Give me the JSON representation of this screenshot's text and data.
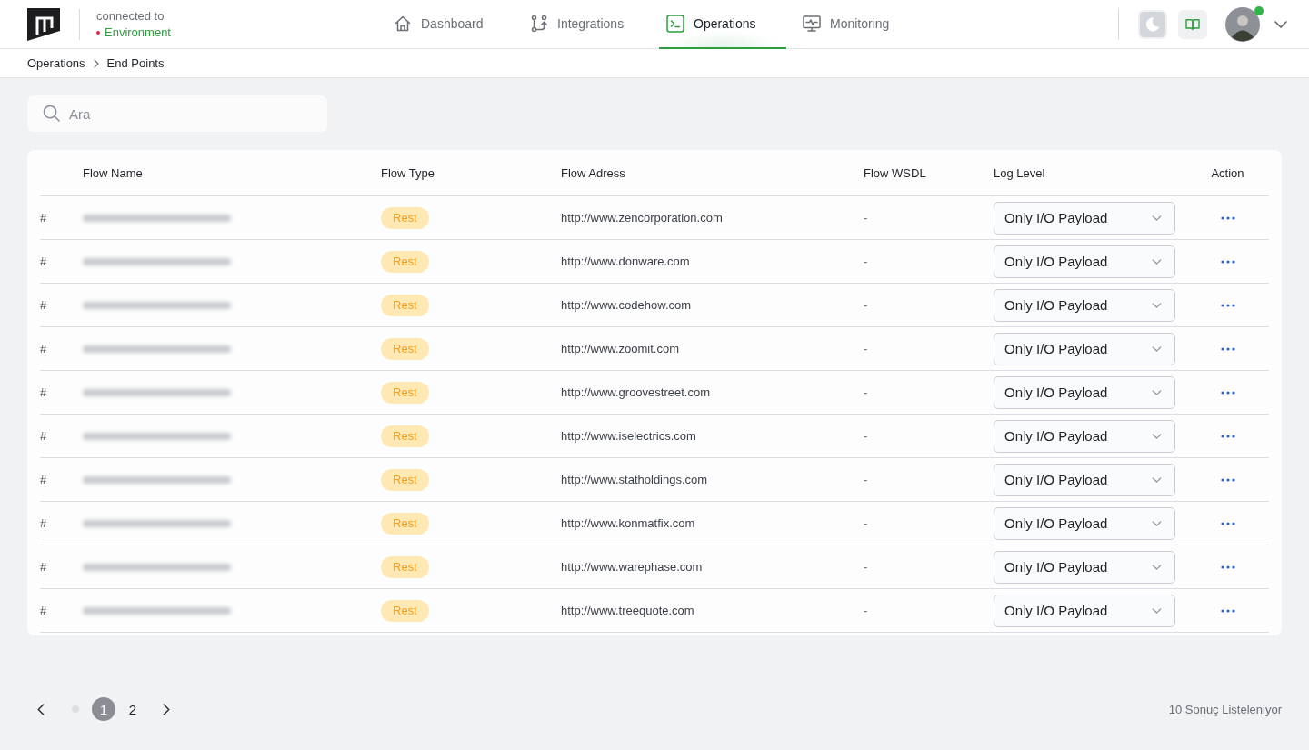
{
  "header": {
    "connection_label": "connected to",
    "environment": "Environment",
    "user": {
      "online": true
    }
  },
  "nav": [
    {
      "label": "Dashboard",
      "selected": false
    },
    {
      "label": "Integrations",
      "selected": false
    },
    {
      "label": "Operations",
      "selected": true
    },
    {
      "label": "Monitoring",
      "selected": false
    }
  ],
  "breadcrumb": [
    "Operations",
    "End Points"
  ],
  "search": {
    "placeholder": "Ara"
  },
  "table": {
    "columns": [
      "Flow Name",
      "Flow Type",
      "Flow Adress",
      "Flow WSDL",
      "Log Level",
      "Action"
    ],
    "rows": [
      {
        "index": "#",
        "flow_type": "Rest",
        "flow_address": "http://www.zencorporation.com",
        "flow_wsdl": "-",
        "log_level": "Only I/O Payload"
      },
      {
        "index": "#",
        "flow_type": "Rest",
        "flow_address": "http://www.donware.com",
        "flow_wsdl": "-",
        "log_level": "Only I/O Payload"
      },
      {
        "index": "#",
        "flow_type": "Rest",
        "flow_address": "http://www.codehow.com",
        "flow_wsdl": "-",
        "log_level": "Only I/O Payload"
      },
      {
        "index": "#",
        "flow_type": "Rest",
        "flow_address": "http://www.zoomit.com",
        "flow_wsdl": "-",
        "log_level": "Only I/O Payload"
      },
      {
        "index": "#",
        "flow_type": "Rest",
        "flow_address": "http://www.groovestreet.com",
        "flow_wsdl": "-",
        "log_level": "Only I/O Payload"
      },
      {
        "index": "#",
        "flow_type": "Rest",
        "flow_address": "http://www.iselectrics.com",
        "flow_wsdl": "-",
        "log_level": "Only I/O Payload"
      },
      {
        "index": "#",
        "flow_type": "Rest",
        "flow_address": "http://www.statholdings.com",
        "flow_wsdl": "-",
        "log_level": "Only I/O Payload"
      },
      {
        "index": "#",
        "flow_type": "Rest",
        "flow_address": "http://www.konmatfix.com",
        "flow_wsdl": "-",
        "log_level": "Only I/O Payload"
      },
      {
        "index": "#",
        "flow_type": "Rest",
        "flow_address": "http://www.warephase.com",
        "flow_wsdl": "-",
        "log_level": "Only I/O Payload"
      },
      {
        "index": "#",
        "flow_type": "Rest",
        "flow_address": "http://www.treequote.com",
        "flow_wsdl": "-",
        "log_level": "Only I/O Payload"
      }
    ]
  },
  "pagination": {
    "pages": [
      {
        "label": "1",
        "selected": true
      },
      {
        "label": "2",
        "selected": false
      }
    ],
    "result_count": "10 Sonuç Listeleniyor"
  }
}
